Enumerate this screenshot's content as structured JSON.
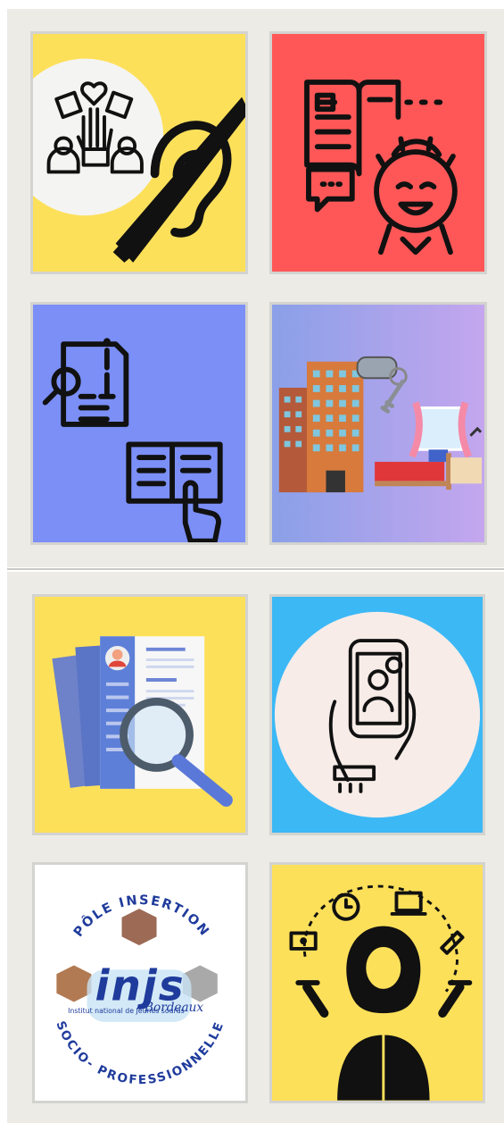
{
  "sections": [
    {
      "name": "top-grid",
      "tiles": [
        {
          "id": "accessibility",
          "icon": "accessibility-hearing-icon",
          "bg": "#fde05a"
        },
        {
          "id": "learning",
          "icon": "learning-mind-icon",
          "bg": "#ff5757"
        },
        {
          "id": "information",
          "icon": "information-document-icon",
          "bg": "#7b8ff7"
        },
        {
          "id": "housing",
          "icon": "housing-apartment-icon",
          "bg": "#b59ee6"
        }
      ]
    },
    {
      "name": "bottom-grid",
      "tiles": [
        {
          "id": "cv-search",
          "icon": "cv-search-icon",
          "bg": "#fde05a"
        },
        {
          "id": "video-call",
          "icon": "video-call-phone-icon",
          "bg": "#3cb8f5"
        },
        {
          "id": "pole-insertion",
          "icon": "pole-insertion-logo",
          "bg": "#ffffff"
        },
        {
          "id": "work-balance",
          "icon": "work-balance-woman-icon",
          "bg": "#fde05a"
        }
      ]
    }
  ],
  "logo": {
    "top_arc": "PÔLE INSERTION",
    "bottom_arc": "SOCIO- PROFESSIONNELLE",
    "wordmark": "injs",
    "subtitle": "Institut national de Jeunes sourds",
    "city": "Bordeaux"
  },
  "colors": {
    "panel": "#ecebe6",
    "yellow": "#fde05a",
    "red": "#ff5757",
    "blue": "#7b8ff7",
    "sky": "#3cb8f5",
    "navy": "#1f3b9c",
    "injs_red": "#e0303a"
  }
}
